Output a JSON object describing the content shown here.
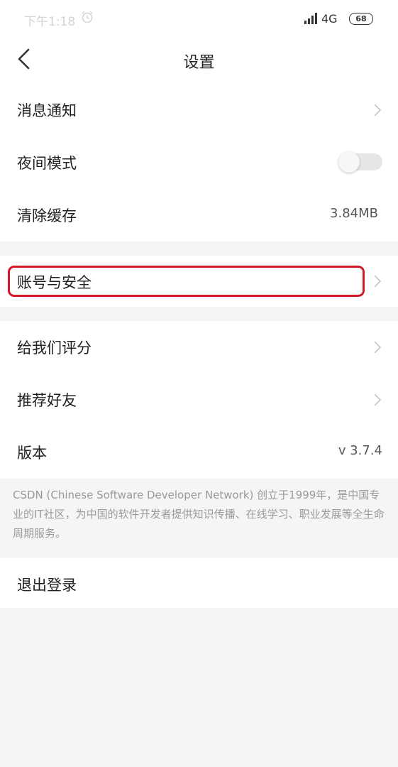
{
  "status_bar": {
    "time": "下午1:18",
    "network": "4G",
    "battery": "68"
  },
  "nav": {
    "title": "设置"
  },
  "section1": [
    {
      "label": "消息通知"
    },
    {
      "label": "夜间模式",
      "toggle_on": false
    },
    {
      "label": "清除缓存",
      "value": "3.84MB"
    }
  ],
  "section2": [
    {
      "label": "账号与安全"
    }
  ],
  "section3": [
    {
      "label": "给我们评分"
    },
    {
      "label": "推荐好友"
    },
    {
      "label": "版本",
      "value": "v 3.7.4"
    }
  ],
  "about": "CSDN (Chinese Software Developer Network) 创立于1999年，是中国专业的IT社区，为中国的软件开发者提供知识传播、在线学习、职业发展等全生命周期服务。",
  "logout": "退出登录",
  "colors": {
    "highlight": "#d01a27",
    "background": "#f5f5f7"
  }
}
